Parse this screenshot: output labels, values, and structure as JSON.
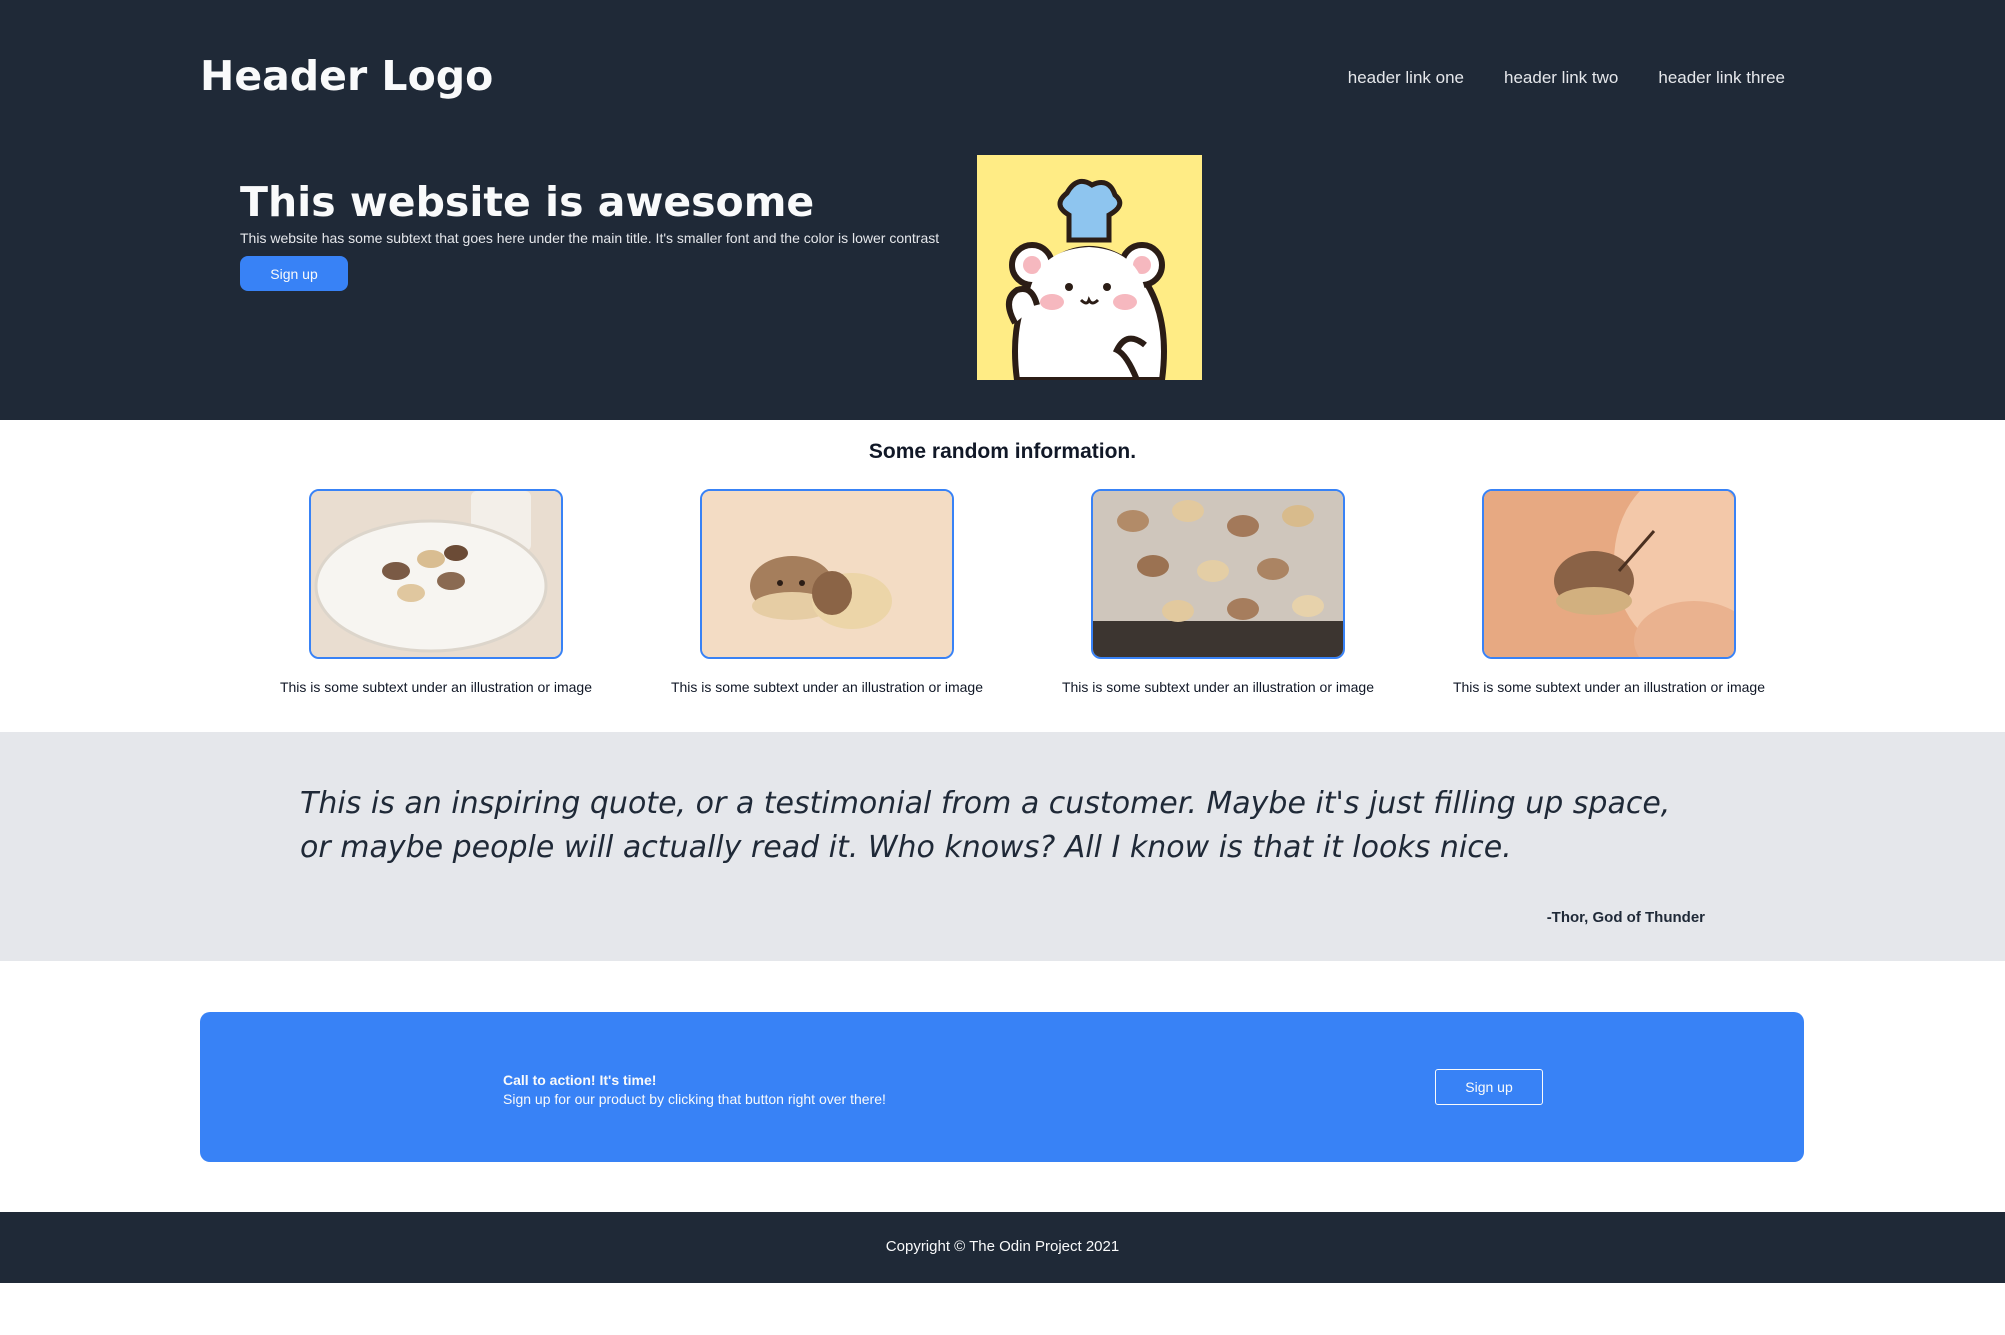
{
  "header": {
    "logo": "Header Logo",
    "nav": [
      "header link one",
      "header link two",
      "header link three"
    ]
  },
  "hero": {
    "title": "This website is awesome",
    "subtitle": "This website has some subtext that goes here under the main title. It's smaller font and the color is lower contrast",
    "button": "Sign up"
  },
  "info": {
    "title": "Some random information.",
    "cards": [
      {
        "caption": "This is some subtext under an illustration or image"
      },
      {
        "caption": "This is some subtext under an illustration or image"
      },
      {
        "caption": "This is some subtext under an illustration or image"
      },
      {
        "caption": "This is some subtext under an illustration or image"
      }
    ]
  },
  "quote": {
    "text": "This is an inspiring quote, or a testimonial from a customer. Maybe it's just filling up space, or maybe people will actually read it. Who knows? All I know is that it looks nice.",
    "author": "-Thor, God of Thunder"
  },
  "cta": {
    "title": "Call to action! It's time!",
    "text": "Sign up for our product by clicking that button right over there!",
    "button": "Sign up"
  },
  "footer": {
    "text": "Copyright © The Odin Project 2021"
  },
  "colors": {
    "dark": "#1f2937",
    "primary": "#3882f6",
    "light": "#f9fafb",
    "quote_bg": "#e5e7eb",
    "hero_image_bg": "#ffec85"
  }
}
